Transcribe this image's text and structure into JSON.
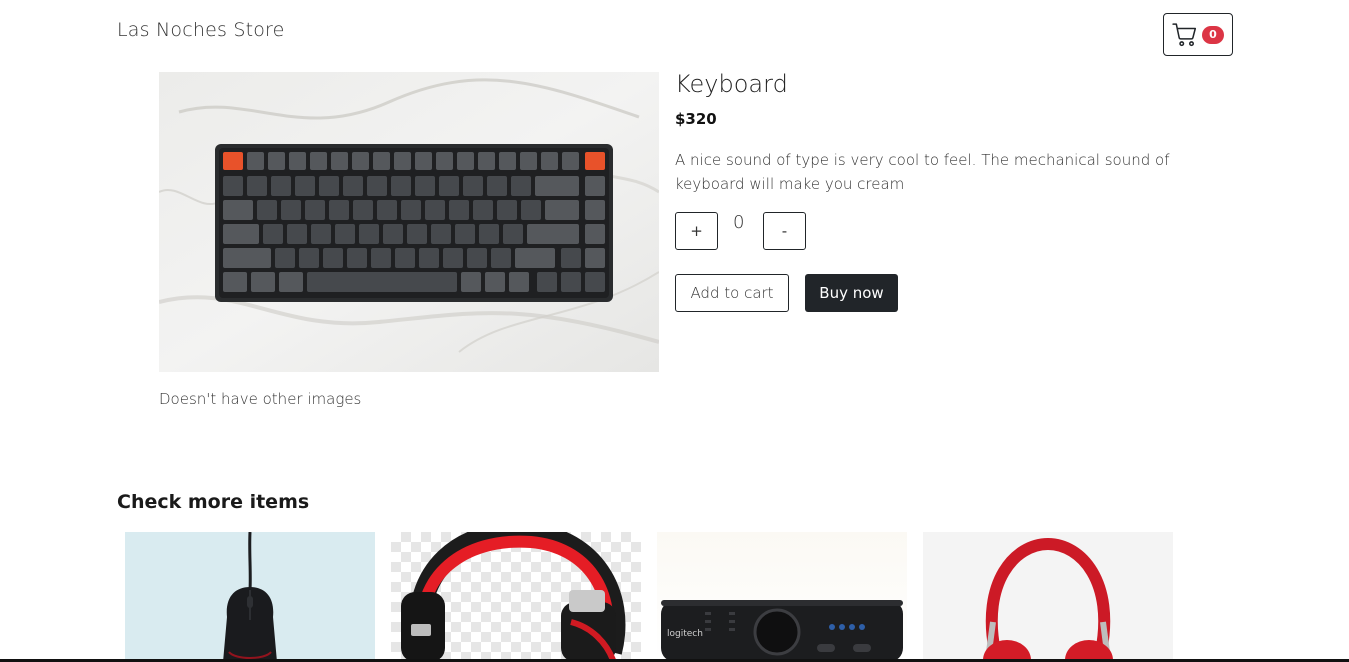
{
  "header": {
    "brand": "Las Noches Store",
    "cart_count": "0"
  },
  "product": {
    "title": "Keyboard",
    "price": "$320",
    "description": "A nice sound of type is very cool to feel. The mechanical sound of keyboard will make you cream",
    "quantity": "0",
    "plus_label": "+",
    "minus_label": "-",
    "add_to_cart_label": "Add to cart",
    "buy_now_label": "Buy now",
    "other_images_note": "Doesn't have other images"
  },
  "more_items": {
    "heading": "Check more items",
    "items": [
      {
        "name": "mouse"
      },
      {
        "name": "red-black-headphones"
      },
      {
        "name": "logitech-speaker-control"
      },
      {
        "name": "red-headphones"
      }
    ]
  },
  "colors": {
    "accent_dark": "#212529",
    "badge": "#dc3545",
    "keyboard_orange": "#e8522a"
  }
}
